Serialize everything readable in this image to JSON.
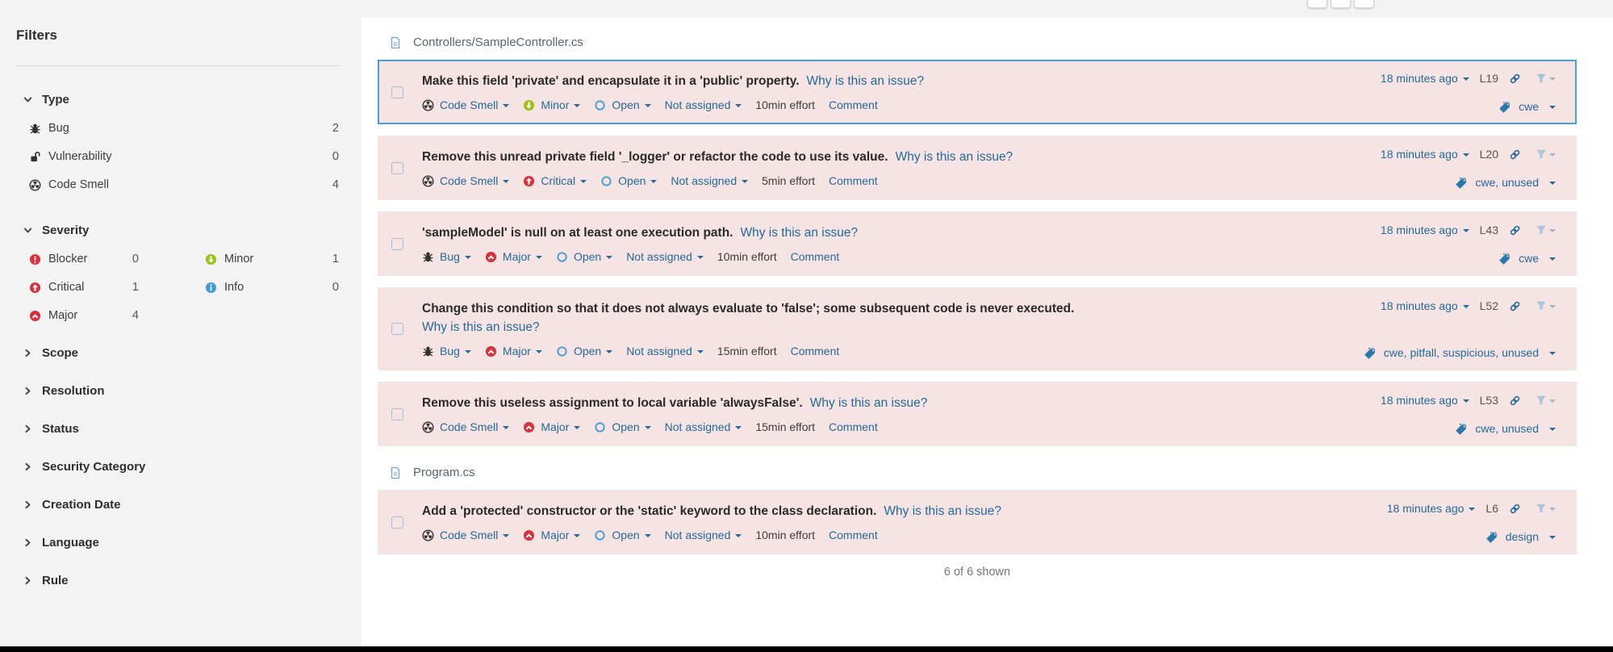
{
  "colors": {
    "accent_blue": "#4b9fd5",
    "link_blue": "#236a97",
    "severity_red": "#d4333f",
    "severity_green": "#9bc119",
    "info_blue": "#459cd2",
    "row_background": "#f6e3e3"
  },
  "sidebar": {
    "title": "Filters",
    "type": {
      "label": "Type",
      "chevron": "chevron-down-icon",
      "items": [
        {
          "icon": "bug-icon",
          "label": "Bug",
          "count": "2"
        },
        {
          "icon": "vulnerability-icon",
          "label": "Vulnerability",
          "count": "0"
        },
        {
          "icon": "code-smell-icon",
          "label": "Code Smell",
          "count": "4"
        }
      ]
    },
    "severity": {
      "label": "Severity",
      "chevron": "chevron-down-icon",
      "col1": [
        {
          "icon": "blocker-icon",
          "label": "Blocker",
          "count": "0"
        },
        {
          "icon": "critical-icon",
          "label": "Critical",
          "count": "1"
        },
        {
          "icon": "major-icon",
          "label": "Major",
          "count": "4"
        }
      ],
      "col2": [
        {
          "icon": "minor-icon",
          "label": "Minor",
          "count": "1"
        },
        {
          "icon": "info-icon",
          "label": "Info",
          "count": "0"
        }
      ]
    },
    "sections": [
      "Scope",
      "Resolution",
      "Status",
      "Security Category",
      "Creation Date",
      "Language",
      "Rule"
    ]
  },
  "groups": [
    {
      "file": "Controllers/SampleController.cs",
      "issues": [
        {
          "selected": true,
          "title": "Make this field 'private' and encapsulate it in a 'public' property.",
          "why": "Why is this an issue?",
          "type": {
            "icon": "code-smell-icon",
            "label": "Code Smell"
          },
          "severity": {
            "icon": "minor-icon",
            "label": "Minor"
          },
          "status": {
            "icon": "open-icon",
            "label": "Open"
          },
          "assignee": "Not assigned",
          "effort": "10min effort",
          "comment": "Comment",
          "age": "18 minutes ago",
          "line": "L19",
          "tags": "cwe"
        },
        {
          "title": "Remove this unread private field '_logger' or refactor the code to use its value.",
          "why": "Why is this an issue?",
          "type": {
            "icon": "code-smell-icon",
            "label": "Code Smell"
          },
          "severity": {
            "icon": "critical-icon",
            "label": "Critical"
          },
          "status": {
            "icon": "open-icon",
            "label": "Open"
          },
          "assignee": "Not assigned",
          "effort": "5min effort",
          "comment": "Comment",
          "age": "18 minutes ago",
          "line": "L20",
          "tags": "cwe, unused"
        },
        {
          "title": "'sampleModel' is null on at least one execution path.",
          "why": "Why is this an issue?",
          "type": {
            "icon": "bug-icon",
            "label": "Bug"
          },
          "severity": {
            "icon": "major-icon",
            "label": "Major"
          },
          "status": {
            "icon": "open-icon",
            "label": "Open"
          },
          "assignee": "Not assigned",
          "effort": "10min effort",
          "comment": "Comment",
          "age": "18 minutes ago",
          "line": "L43",
          "tags": "cwe"
        },
        {
          "why_block": true,
          "title": "Change this condition so that it does not always evaluate to 'false'; some subsequent code is never executed.",
          "why": "Why is this an issue?",
          "type": {
            "icon": "bug-icon",
            "label": "Bug"
          },
          "severity": {
            "icon": "major-icon",
            "label": "Major"
          },
          "status": {
            "icon": "open-icon",
            "label": "Open"
          },
          "assignee": "Not assigned",
          "effort": "15min effort",
          "comment": "Comment",
          "age": "18 minutes ago",
          "line": "L52",
          "tags": "cwe, pitfall, suspicious, unused"
        },
        {
          "title": "Remove this useless assignment to local variable 'alwaysFalse'.",
          "why": "Why is this an issue?",
          "type": {
            "icon": "code-smell-icon",
            "label": "Code Smell"
          },
          "severity": {
            "icon": "major-icon",
            "label": "Major"
          },
          "status": {
            "icon": "open-icon",
            "label": "Open"
          },
          "assignee": "Not assigned",
          "effort": "15min effort",
          "comment": "Comment",
          "age": "18 minutes ago",
          "line": "L53",
          "tags": "cwe, unused"
        }
      ]
    },
    {
      "file": "Program.cs",
      "issues": [
        {
          "title": "Add a 'protected' constructor or the 'static' keyword to the class declaration.",
          "why": "Why is this an issue?",
          "type": {
            "icon": "code-smell-icon",
            "label": "Code Smell"
          },
          "severity": {
            "icon": "major-icon",
            "label": "Major"
          },
          "status": {
            "icon": "open-icon",
            "label": "Open"
          },
          "assignee": "Not assigned",
          "effort": "10min effort",
          "comment": "Comment",
          "age": "18 minutes ago",
          "line": "L6",
          "tags": "design"
        }
      ]
    }
  ],
  "footer": {
    "shown": "6 of 6 shown"
  }
}
